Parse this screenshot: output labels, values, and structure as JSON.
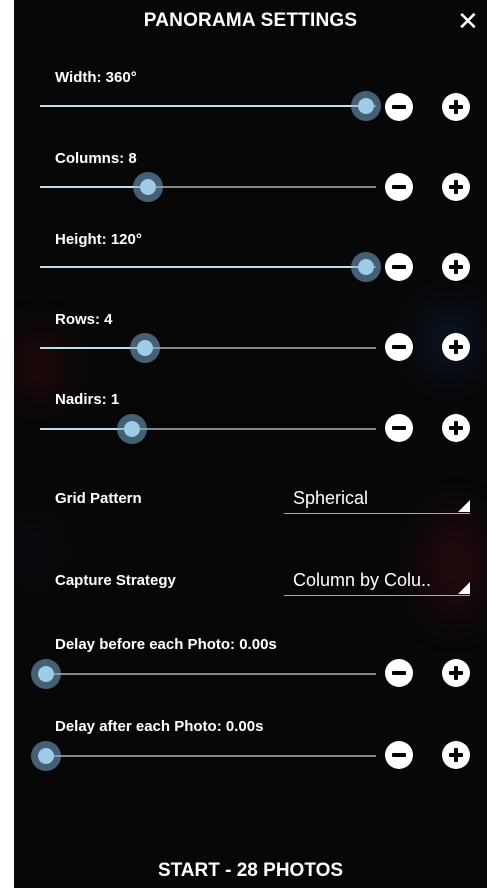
{
  "header": {
    "title": "PANORAMA SETTINGS",
    "close_glyph": "✕"
  },
  "sliders": [
    {
      "label": "Width: 360°",
      "value": 1.0
    },
    {
      "label": "Columns: 8",
      "value": 0.32
    },
    {
      "label": "Height: 120°",
      "value": 1.0
    },
    {
      "label": "Rows: 4",
      "value": 0.31
    },
    {
      "label": "Nadirs: 1",
      "value": 0.27
    }
  ],
  "dropdowns": [
    {
      "label": "Grid Pattern",
      "value": "Spherical"
    },
    {
      "label": "Capture Strategy",
      "value": "Column by Colu.."
    }
  ],
  "delays": [
    {
      "label": "Delay before each Photo: 0.00s",
      "value": 0.0
    },
    {
      "label": "Delay after each Photo: 0.00s",
      "value": 0.0
    }
  ],
  "footer": {
    "start_label": "START - 28 PHOTOS"
  },
  "colors": {
    "background": "#070707",
    "track_fill": "#bfe0f2",
    "thumb": "#9ecbe6",
    "text": "#ffffff"
  },
  "icons": {
    "minus": "minus-icon",
    "plus": "plus-icon",
    "close": "close-icon",
    "dropdown": "dropdown-triangle-icon"
  }
}
